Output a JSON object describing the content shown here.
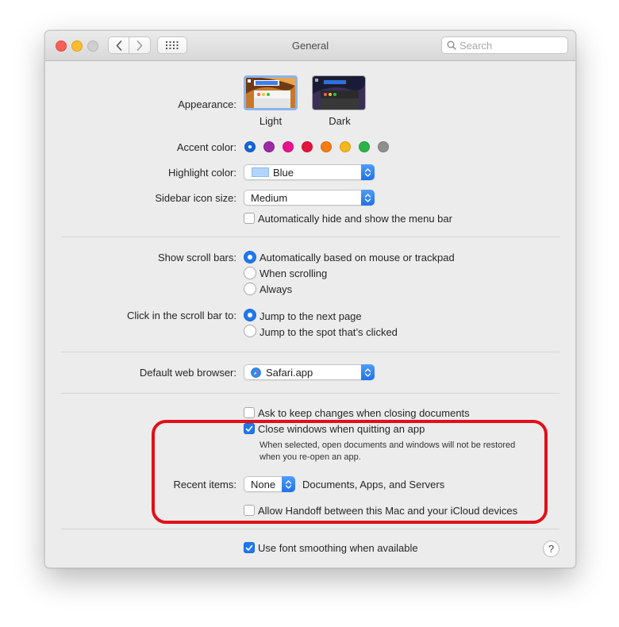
{
  "window": {
    "title": "General"
  },
  "toolbar": {
    "search_placeholder": "Search"
  },
  "appearance": {
    "label": "Appearance:",
    "options": [
      {
        "name": "Light",
        "selected": true
      },
      {
        "name": "Dark",
        "selected": false
      }
    ]
  },
  "accent": {
    "label": "Accent color:",
    "colors": [
      "#1565d8",
      "#9b2aa5",
      "#e7148f",
      "#e3143d",
      "#f57c12",
      "#f4b71c",
      "#2cb34a",
      "#8f8f8f"
    ],
    "selected_index": 0
  },
  "highlight_color": {
    "label": "Highlight color:",
    "value": "Blue",
    "swatch": "#b3d4fd"
  },
  "sidebar_icon_size": {
    "label": "Sidebar icon size:",
    "value": "Medium"
  },
  "menu_bar": {
    "label": "Automatically hide and show the menu bar",
    "checked": false
  },
  "scroll_bars": {
    "label": "Show scroll bars:",
    "options": [
      "Automatically based on mouse or trackpad",
      "When scrolling",
      "Always"
    ],
    "selected_index": 0
  },
  "click_scroll": {
    "label": "Click in the scroll bar to:",
    "options": [
      "Jump to the next page",
      "Jump to the spot that’s clicked"
    ],
    "selected_index": 0
  },
  "browser": {
    "label": "Default web browser:",
    "value": "Safari.app"
  },
  "ask_keep": {
    "label": "Ask to keep changes when closing documents",
    "checked": false
  },
  "close_windows": {
    "label": "Close windows when quitting an app",
    "checked": true,
    "note_line1": "When selected, open documents and windows will not be restored",
    "note_line2": "when you re-open an app."
  },
  "recent_items": {
    "label": "Recent items:",
    "value": "None",
    "suffix": "Documents, Apps, and Servers"
  },
  "handoff": {
    "label": "Allow Handoff between this Mac and your iCloud devices",
    "checked": false
  },
  "font_smoothing": {
    "label": "Use font smoothing when available",
    "checked": true
  },
  "help": {
    "glyph": "?"
  },
  "annotation": {
    "color": "#e0101a"
  }
}
